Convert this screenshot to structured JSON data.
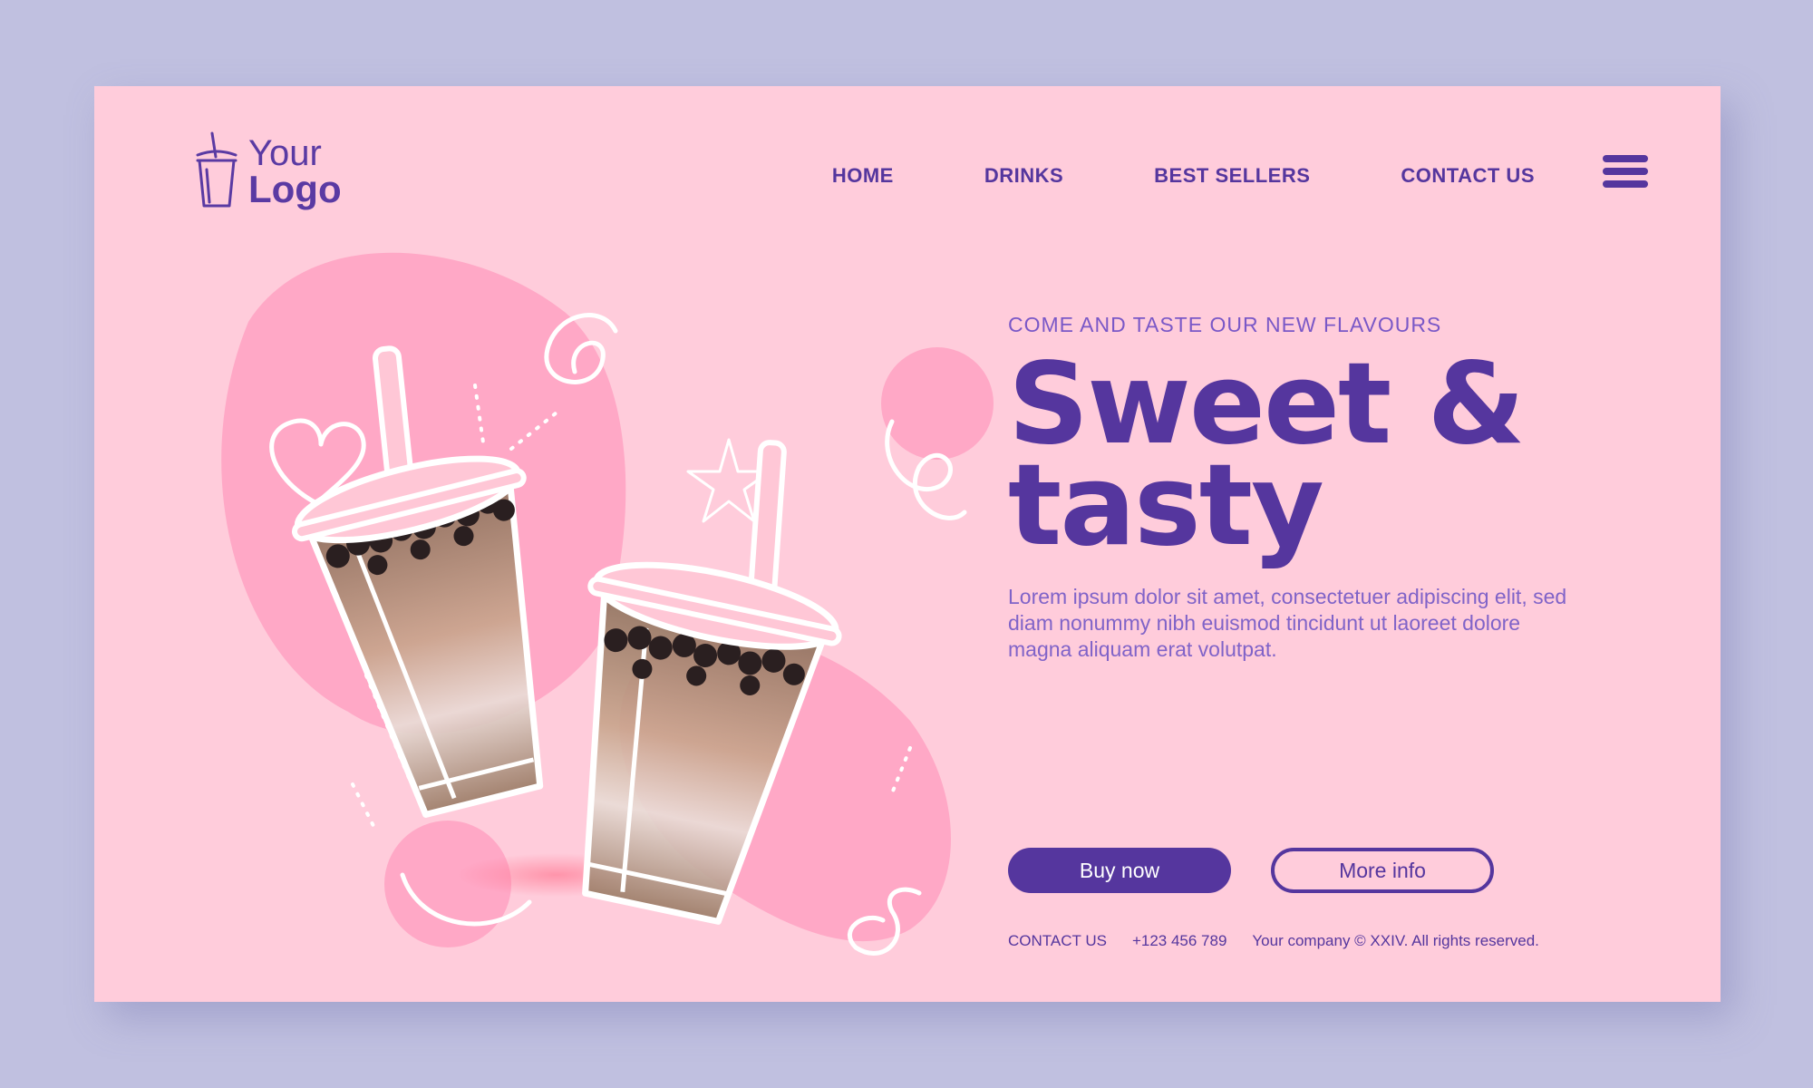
{
  "logo": {
    "line1": "Your",
    "line2": "Logo",
    "icon": "boba-cup-icon"
  },
  "nav": {
    "items": [
      {
        "label": "HOME"
      },
      {
        "label": "DRINKS"
      },
      {
        "label": "BEST SELLERS"
      },
      {
        "label": "CONTACT US"
      }
    ],
    "menu_icon": "hamburger-menu-icon"
  },
  "hero": {
    "tagline": "COME AND TASTE OUR NEW FLAVOURS",
    "headline_line1": "Sweet &",
    "headline_line2": "tasty",
    "description": "Lorem ipsum dolor sit amet, consectetuer adipiscing elit, sed diam nonummy nibh euismod tincidunt ut laoreet dolore magna aliquam erat volutpat.",
    "buy_label": "Buy now",
    "more_label": "More info"
  },
  "footer": {
    "contact_label": "CONTACT US",
    "phone": "+123 456 789",
    "copyright": "Your company © XXIV. All rights reserved."
  },
  "colors": {
    "background": "#c0c0e0",
    "card": "#ffccdb",
    "accent": "#55369e",
    "blob": "#ffa8c6"
  }
}
